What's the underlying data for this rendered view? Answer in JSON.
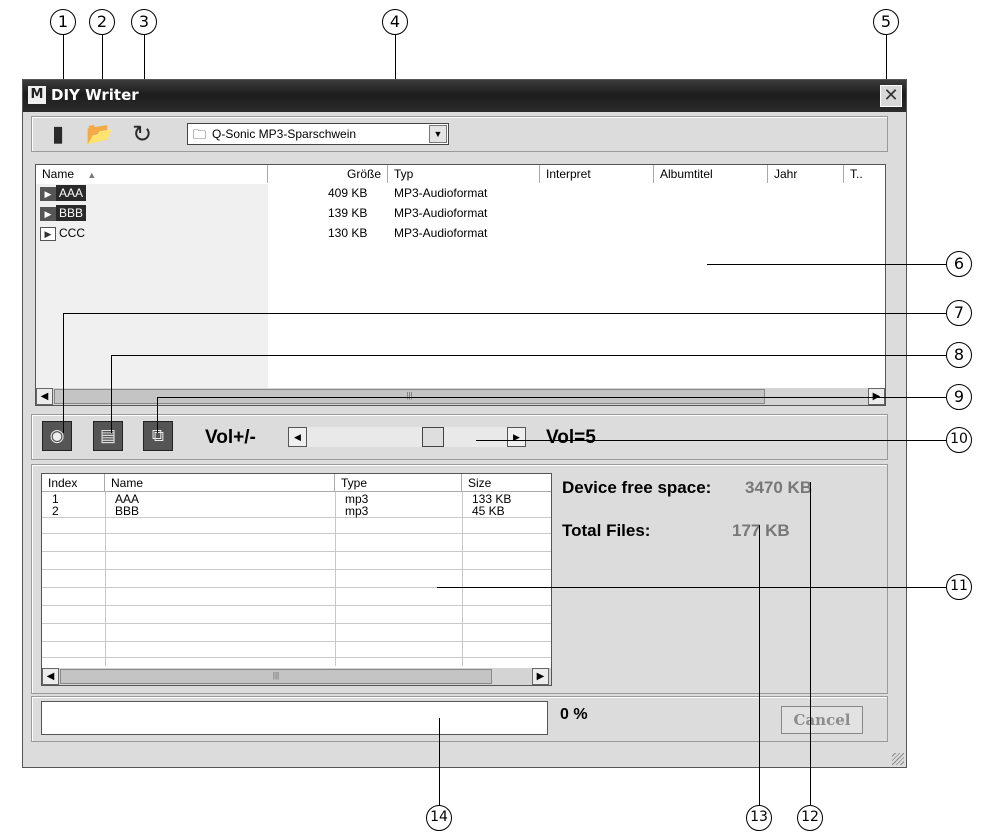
{
  "window": {
    "title": "DIY Writer",
    "title_icon": "M",
    "close": "✕"
  },
  "toolbar": {
    "icons": [
      "load-icon",
      "open-folder-icon",
      "refresh-icon"
    ],
    "device_select": "Q-Sonic MP3-Sparschwein"
  },
  "file_list": {
    "columns": [
      "Name",
      "Größe",
      "Typ",
      "Interpret",
      "Albumtitel",
      "Jahr",
      "T.."
    ],
    "sort_indicator": "▲",
    "rows": [
      {
        "name": "AAA",
        "size": "409 KB",
        "type": "MP3-Audioformat"
      },
      {
        "name": "BBB",
        "size": "139 KB",
        "type": "MP3-Audioformat"
      },
      {
        "name": "CCC",
        "size": "130 KB",
        "type": "MP3-Audioformat"
      }
    ]
  },
  "controls": {
    "icons": [
      "play-icon",
      "delete-icon",
      "transfer-icon"
    ],
    "vol_label": "Vol+/-",
    "vol_value": "Vol=5",
    "vol_level": 5
  },
  "queue": {
    "columns": [
      "Index",
      "Name",
      "Type",
      "Size"
    ],
    "rows": [
      {
        "index": "1",
        "name": "AAA",
        "type": "mp3",
        "size": "133 KB"
      },
      {
        "index": "2",
        "name": "BBB",
        "type": "mp3",
        "size": "45 KB"
      }
    ]
  },
  "info": {
    "free_label": "Device free space:",
    "free_value": "3470 KB",
    "total_label": "Total Files:",
    "total_value": "177 KB"
  },
  "progress": {
    "percent_text": "0 %",
    "value": 0
  },
  "cancel_label": "Cancel",
  "callouts": [
    "1",
    "2",
    "3",
    "4",
    "5",
    "6",
    "7",
    "8",
    "9",
    "10",
    "11",
    "12",
    "13",
    "14"
  ]
}
